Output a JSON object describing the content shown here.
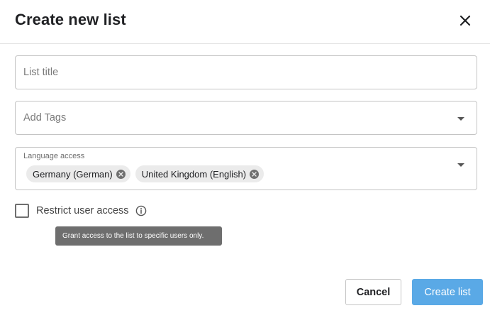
{
  "dialog": {
    "title": "Create new list"
  },
  "fields": {
    "list_title": {
      "placeholder": "List title",
      "value": ""
    },
    "tags": {
      "placeholder": "Add Tags"
    },
    "language_access": {
      "label": "Language access",
      "chips": [
        "Germany (German)",
        "United Kingdom (English)"
      ]
    }
  },
  "restrict": {
    "label": "Restrict user access",
    "checked": false,
    "tooltip": "Grant access to the list to specific users only."
  },
  "actions": {
    "cancel_label": "Cancel",
    "create_label": "Create list"
  },
  "colors": {
    "primary": "#5aa9e6",
    "tooltip_bg": "#6e6e6e",
    "chip_bg": "#ebebeb",
    "border": "#c4c4c4"
  },
  "icons": {
    "close": "close-icon",
    "dropdown": "chevron-down-icon",
    "chip_remove": "remove-chip-icon",
    "info": "info-icon"
  }
}
